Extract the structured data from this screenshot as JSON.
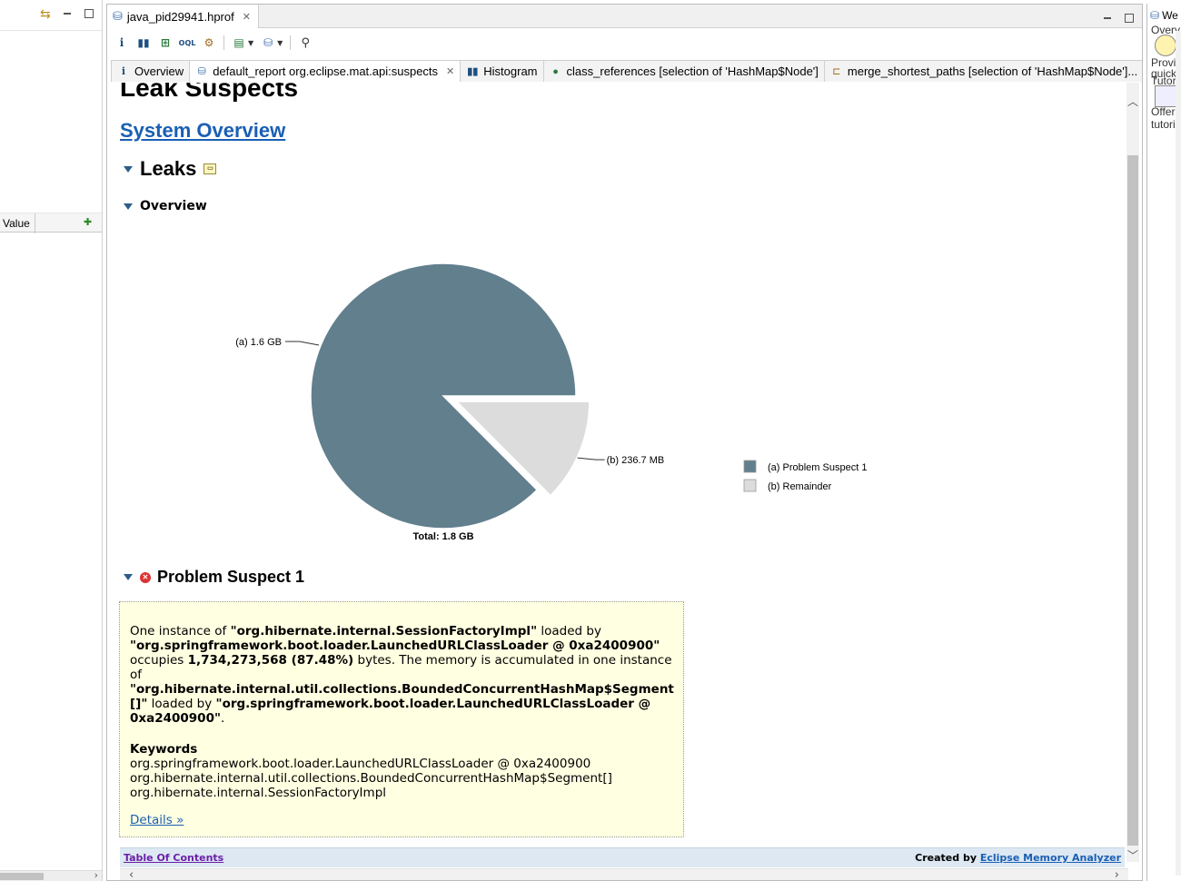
{
  "editor": {
    "title": "java_pid29941.hprof"
  },
  "left_view": {
    "column_value": "Value"
  },
  "report_tabs": [
    {
      "label": "Overview"
    },
    {
      "label": "default_report  org.eclipse.mat.api:suspects"
    },
    {
      "label": "Histogram"
    },
    {
      "label": "class_references [selection of 'HashMap$Node']"
    },
    {
      "label": "merge_shortest_paths [selection of 'HashMap$Node']..."
    }
  ],
  "report": {
    "heading": "Leak Suspects",
    "system_overview": "System Overview",
    "leaks": "Leaks",
    "overview": "Overview",
    "problem_suspect": "Problem Suspect 1",
    "problem": {
      "p1": "One instance of ",
      "p1b": "\"org.hibernate.internal.SessionFactoryImpl\"",
      "p2": " loaded by ",
      "p2b": "\"org.springframework.boot.loader.LaunchedURLClassLoader @ 0xa2400900\"",
      "p3": " occupies ",
      "p3b": "1,734,273,568 (87.48%)",
      "p4": " bytes. The memory is accumulated in one instance of ",
      "p4b": "\"org.hibernate.internal.util.collections.BoundedConcurrentHashMap$Segment []\"",
      "p5": " loaded by ",
      "p5b": "\"org.springframework.boot.loader.LaunchedURLClassLoader @ 0xa2400900\"",
      "p6": ".",
      "keywords_title": "Keywords",
      "keywords": [
        "org.springframework.boot.loader.LaunchedURLClassLoader @ 0xa2400900",
        "org.hibernate.internal.util.collections.BoundedConcurrentHashMap$Segment[]",
        "org.hibernate.internal.SessionFactoryImpl"
      ],
      "details": "Details »"
    },
    "footer": {
      "toc": "Table Of Contents",
      "created_by": "Created by ",
      "created_link": "Eclipse Memory Analyzer"
    }
  },
  "right_view": {
    "tab": "We",
    "lines": [
      "Overv",
      "Provid",
      "quick",
      "Tutoria",
      "Offers",
      "tutoria"
    ]
  },
  "chart_data": {
    "type": "pie",
    "total_label": "Total: 1.8 GB",
    "slices": [
      {
        "label": "(a)  1.6 GB",
        "legend": "(a)  Problem Suspect 1",
        "value": 1734273568,
        "color": "#627f8e"
      },
      {
        "label": "(b)  236.7 MB",
        "legend": "(b)  Remainder",
        "value": 248200000,
        "color": "#dcdcdc"
      }
    ]
  },
  "colors": {
    "accent_link": "#1a5fb4",
    "problem_bg": "#ffffe1",
    "footer_bg": "#dde8f2"
  }
}
